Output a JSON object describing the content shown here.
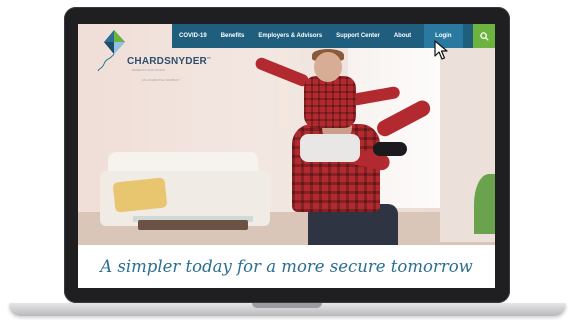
{
  "nav": {
    "items": [
      "COVID-19",
      "Benefits",
      "Employers & Advisors",
      "Support Center",
      "About"
    ],
    "login_label": "Login",
    "search_icon": "search-icon"
  },
  "logo": {
    "name": "CHARDSNYDER",
    "trademark": "™",
    "tagline": "BENEFITS SOLUTIONS",
    "subline": "AN ACCRETIVE COMPANY"
  },
  "hero": {
    "tagline": "A simpler today for a more secure tomorrow"
  },
  "colors": {
    "nav_bg": "#1f5f7d",
    "login_bg": "#2a79a0",
    "search_bg": "#6cb43f",
    "tagline_text": "#2a6e92",
    "logo_text": "#2f4f6c"
  }
}
